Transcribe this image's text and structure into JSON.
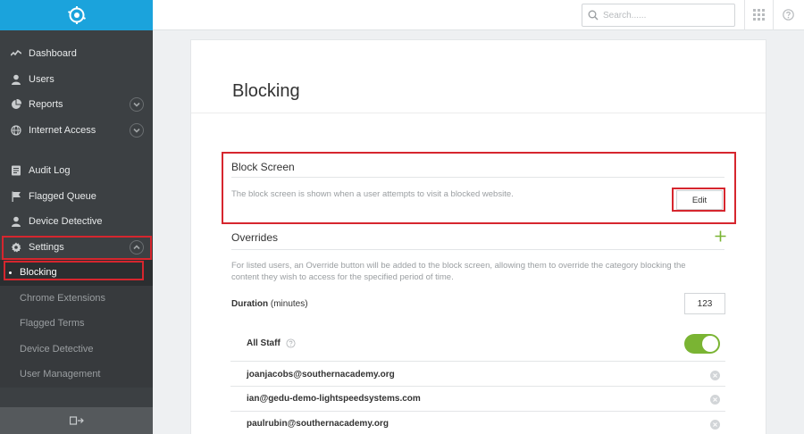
{
  "sidebar": {
    "items": [
      {
        "label": "Dashboard",
        "icon": "activity-icon"
      },
      {
        "label": "Users",
        "icon": "user-icon"
      },
      {
        "label": "Reports",
        "icon": "pie-chart-icon"
      },
      {
        "label": "Internet Access",
        "icon": "globe-icon"
      },
      {
        "label": "Audit Log",
        "icon": "list-icon"
      },
      {
        "label": "Flagged Queue",
        "icon": "flag-icon"
      },
      {
        "label": "Device Detective",
        "icon": "user-icon"
      },
      {
        "label": "Settings",
        "icon": "gear-icon"
      }
    ],
    "sub_items": [
      {
        "label": "Blocking"
      },
      {
        "label": "Chrome Extensions"
      },
      {
        "label": "Flagged Terms"
      },
      {
        "label": "Device Detective"
      },
      {
        "label": "User Management"
      }
    ]
  },
  "topbar": {
    "search_placeholder": "Search......"
  },
  "page": {
    "title": "Blocking"
  },
  "block_screen": {
    "heading": "Block Screen",
    "description": "The block screen is shown when a user attempts to visit a blocked website.",
    "edit_label": "Edit"
  },
  "overrides": {
    "heading": "Overrides",
    "description_line1": "For listed users, an Override button will be added to the block screen, allowing them to override the category blocking the",
    "description_line2": "content they wish to access for the specified period of time.",
    "duration_label": "Duration",
    "duration_unit": "(minutes)",
    "duration_value": "123",
    "all_staff_label": "All Staff",
    "all_staff_enabled": true,
    "users": [
      {
        "email": "joanjacobs@southernacademy.org"
      },
      {
        "email": "ian@gedu-demo-lightspeedsystems.com"
      },
      {
        "email": "paulrubin@southernacademy.org"
      }
    ]
  },
  "colors": {
    "accent": "#1ba3dc",
    "sidebar_bg": "#3c4043",
    "toggle_on": "#7ab433",
    "highlight": "#d6262e"
  }
}
